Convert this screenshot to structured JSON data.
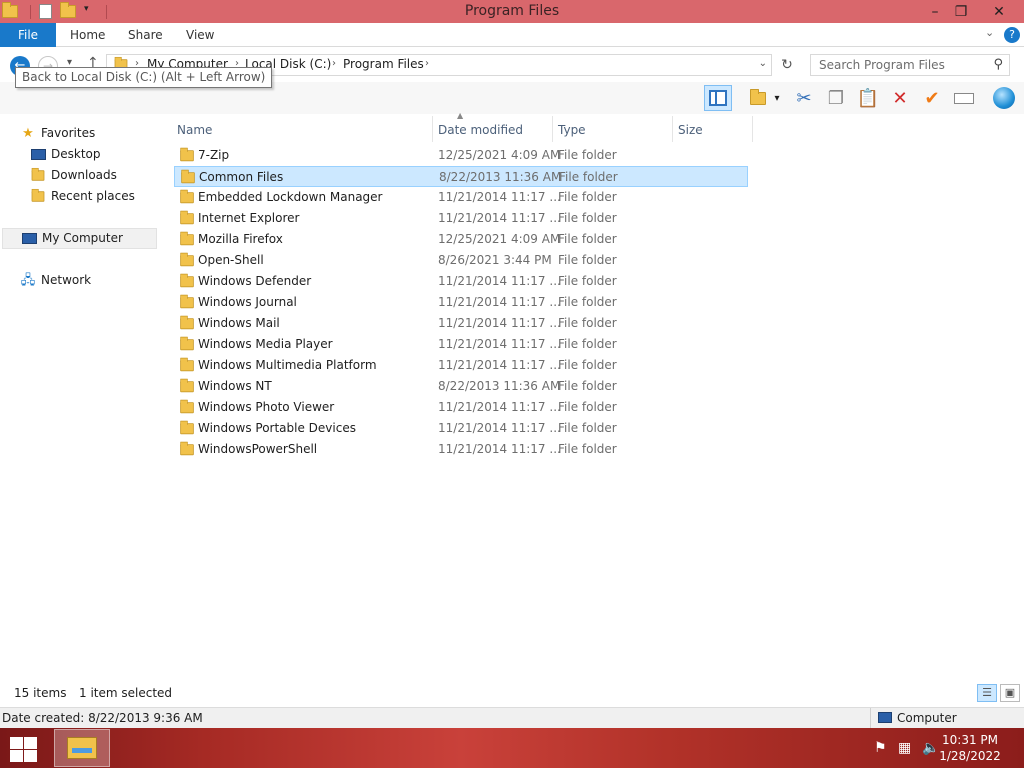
{
  "window": {
    "title": "Program Files",
    "minimize": "–",
    "maximize": "❐",
    "close": "✕"
  },
  "ribbon": {
    "tabs": [
      "File",
      "Home",
      "Share",
      "View"
    ],
    "help": "?",
    "expand": "⌄"
  },
  "nav": {
    "back_tooltip": "Back to Local Disk (C:) (Alt + Left Arrow)",
    "breadcrumb": [
      "My Computer",
      "Local Disk (C:)",
      "Program Files"
    ],
    "search_placeholder": "Search Program Files"
  },
  "toolbar": {
    "icons": [
      "preview-pane-icon",
      "new-folder-icon",
      "cut-icon",
      "copy-icon",
      "paste-icon",
      "delete-icon",
      "select-icon",
      "rename-icon",
      "internet-icon"
    ]
  },
  "sidebar": {
    "favorites": {
      "label": "Favorites"
    },
    "items": [
      {
        "label": "Desktop"
      },
      {
        "label": "Downloads"
      },
      {
        "label": "Recent places"
      }
    ],
    "computer": {
      "label": "My Computer"
    },
    "network": {
      "label": "Network"
    }
  },
  "filelist": {
    "columns": [
      "Name",
      "Date modified",
      "Type",
      "Size"
    ],
    "selected_index": 1,
    "rows": [
      {
        "name": "7-Zip",
        "date": "12/25/2021 4:09 AM",
        "type": "File folder"
      },
      {
        "name": "Common Files",
        "date": "8/22/2013 11:36 AM",
        "type": "File folder"
      },
      {
        "name": "Embedded Lockdown Manager",
        "date": "11/21/2014 11:17 ...",
        "type": "File folder"
      },
      {
        "name": "Internet Explorer",
        "date": "11/21/2014 11:17 ...",
        "type": "File folder"
      },
      {
        "name": "Mozilla Firefox",
        "date": "12/25/2021 4:09 AM",
        "type": "File folder"
      },
      {
        "name": "Open-Shell",
        "date": "8/26/2021 3:44 PM",
        "type": "File folder"
      },
      {
        "name": "Windows Defender",
        "date": "11/21/2014 11:17 ...",
        "type": "File folder"
      },
      {
        "name": "Windows Journal",
        "date": "11/21/2014 11:17 ...",
        "type": "File folder"
      },
      {
        "name": "Windows Mail",
        "date": "11/21/2014 11:17 ...",
        "type": "File folder"
      },
      {
        "name": "Windows Media Player",
        "date": "11/21/2014 11:17 ...",
        "type": "File folder"
      },
      {
        "name": "Windows Multimedia Platform",
        "date": "11/21/2014 11:17 ...",
        "type": "File folder"
      },
      {
        "name": "Windows NT",
        "date": "8/22/2013 11:36 AM",
        "type": "File folder"
      },
      {
        "name": "Windows Photo Viewer",
        "date": "11/21/2014 11:17 ...",
        "type": "File folder"
      },
      {
        "name": "Windows Portable Devices",
        "date": "11/21/2014 11:17 ...",
        "type": "File folder"
      },
      {
        "name": "WindowsPowerShell",
        "date": "11/21/2014 11:17 ...",
        "type": "File folder"
      }
    ]
  },
  "status": {
    "item_count": "15 items",
    "selection": "1 item selected",
    "details": "Date created: 8/22/2013 9:36 AM",
    "location": "Computer"
  },
  "taskbar": {
    "time": "10:31 PM",
    "date": "1/28/2022"
  },
  "colors": {
    "titlebar": "#d9676c",
    "accent": "#1979ca",
    "selection": "#cce8ff"
  }
}
